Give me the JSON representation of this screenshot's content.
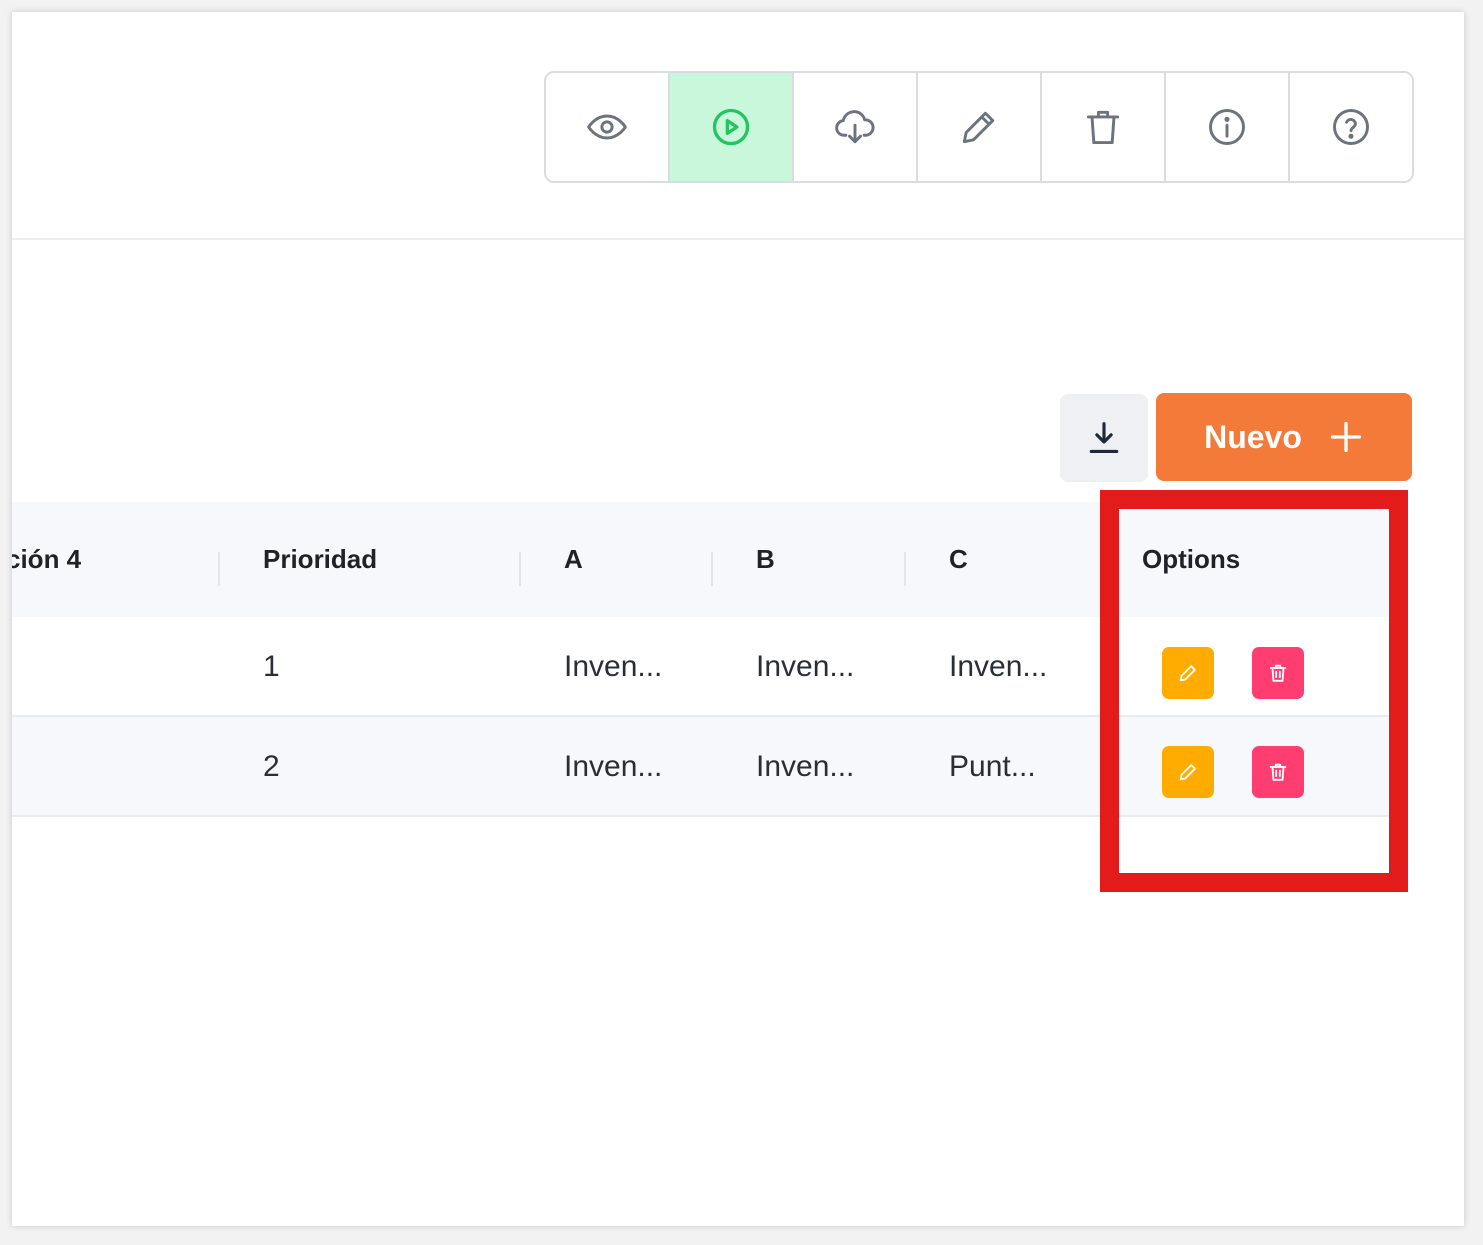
{
  "toolbar": {
    "buttons": [
      {
        "icon": "eye-icon"
      },
      {
        "icon": "play-circle-icon",
        "active": true
      },
      {
        "icon": "cloud-download-icon"
      },
      {
        "icon": "pencil-icon"
      },
      {
        "icon": "trash-icon"
      },
      {
        "icon": "info-icon"
      },
      {
        "icon": "help-icon"
      }
    ],
    "active_color": "#c8f7dc",
    "accent_color": "#22c55e"
  },
  "actions": {
    "new_label": "Nuevo",
    "new_color": "#f47a3a"
  },
  "table": {
    "columns": [
      "ción 4",
      "Prioridad",
      "A",
      "B",
      "C",
      "Options"
    ],
    "rows": [
      {
        "prioridad": "1",
        "a": "Inven...",
        "b": "Inven...",
        "c": "Inven..."
      },
      {
        "prioridad": "2",
        "a": "Inven...",
        "b": "Inven...",
        "c": "Punt..."
      }
    ],
    "edit_color": "#ffab00",
    "delete_color": "#ff3d71"
  },
  "highlight_color": "#e31b1b"
}
